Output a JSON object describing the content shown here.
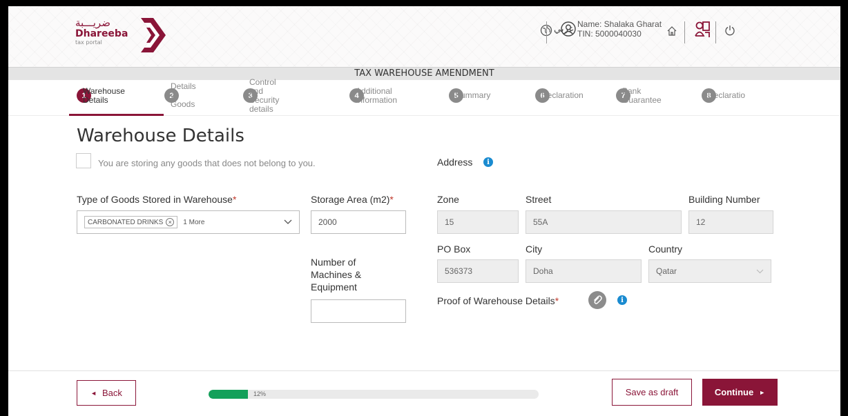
{
  "header": {
    "logo_arabic": "ضريـــبة",
    "logo_name": "Dhareeba",
    "logo_sub": "tax portal",
    "language_label": "عربي",
    "user_name": "Name: Shalaka Gharat",
    "user_tin": "TIN: 5000040030",
    "icons": [
      "globe-icon",
      "user-icon",
      "home-icon",
      "org-chart-icon",
      "power-icon"
    ]
  },
  "title_bar": "TAX WAREHOUSE AMENDMENT",
  "steps": [
    {
      "num": "1",
      "label": "Warehouse\nDetails",
      "active": true
    },
    {
      "num": "2",
      "label": "Details of\nGoods",
      "active": false
    },
    {
      "num": "3",
      "label": "Control and\nSecurity details",
      "active": false
    },
    {
      "num": "4",
      "label": "Additional\nInformation",
      "active": false
    },
    {
      "num": "5",
      "label": "Summary",
      "active": false
    },
    {
      "num": "6",
      "label": "Declaration",
      "active": false
    },
    {
      "num": "7",
      "label": "Bank\nGuarantee",
      "active": false
    },
    {
      "num": "8",
      "label": "Declaratio",
      "active": false
    }
  ],
  "page_title": "Warehouse Details",
  "checkbox_label": "You are storing any goods that does not belong to you.",
  "form": {
    "goods_type_label": "Type of Goods Stored in Warehouse",
    "goods_chip": "CARBONATED DRINKS",
    "goods_more": "1 More",
    "storage_label": "Storage Area (m2)",
    "storage_value": "2000",
    "machines_label": "Number of\nMachines &\nEquipment",
    "machines_value": "",
    "required_mark": "*"
  },
  "address": {
    "heading": "Address",
    "zone_label": "Zone",
    "zone_value": "15",
    "street_label": "Street",
    "street_value": "55A",
    "building_label": "Building Number",
    "building_value": "12",
    "pobox_label": "PO Box",
    "pobox_value": "536373",
    "city_label": "City",
    "city_value": "Doha",
    "country_label": "Country",
    "country_value": "Qatar",
    "proof_label": "Proof of Warehouse Details"
  },
  "footer": {
    "back_label": "Back",
    "progress_percent": 12,
    "progress_label": "12%",
    "draft_label": "Save as draft",
    "continue_label": "Continue"
  },
  "colors": {
    "brand": "#8a1538",
    "progress": "#14a05a",
    "info": "#1a8bd0"
  }
}
